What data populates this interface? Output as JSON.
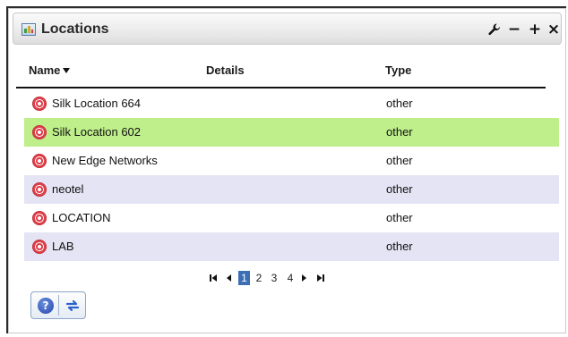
{
  "panel": {
    "title": "Locations",
    "header_buttons": [
      {
        "name": "settings-wrench",
        "icon": "wrench-icon"
      },
      {
        "name": "minimize",
        "icon": "minus-icon",
        "glyph": "−"
      },
      {
        "name": "add",
        "icon": "plus-icon",
        "glyph": "+"
      },
      {
        "name": "close",
        "icon": "close-icon",
        "glyph": "×"
      }
    ]
  },
  "table": {
    "columns": [
      "Name",
      "Details",
      "Type"
    ],
    "sort_column": "Name",
    "rows": [
      {
        "name": "Silk Location 664",
        "details": "",
        "type": "other",
        "style": "plain"
      },
      {
        "name": "Silk Location 602",
        "details": "",
        "type": "other",
        "style": "selected"
      },
      {
        "name": "New Edge Networks",
        "details": "",
        "type": "other",
        "style": "plain"
      },
      {
        "name": "neotel",
        "details": "",
        "type": "other",
        "style": "alt"
      },
      {
        "name": "LOCATION",
        "details": "",
        "type": "other",
        "style": "plain"
      },
      {
        "name": "LAB",
        "details": "",
        "type": "other",
        "style": "alt"
      }
    ]
  },
  "pagination": {
    "pages": [
      "1",
      "2",
      "3",
      "4"
    ],
    "current_page": "1"
  },
  "footer": {
    "help_label": "?",
    "help_icon": "help-icon",
    "swap_icon": "swap-arrows-icon"
  },
  "colors": {
    "selected_row": "#bfef8b",
    "alt_row": "#e4e4f4",
    "current_page": "#3c6fb3",
    "location_icon": "#e0404a"
  }
}
